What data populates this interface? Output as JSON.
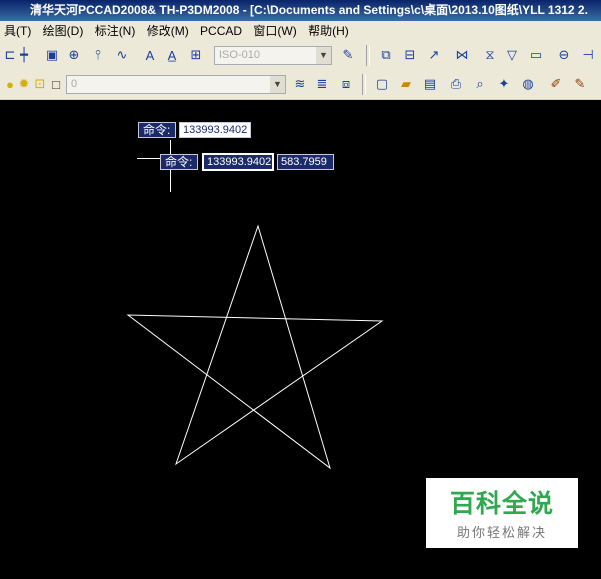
{
  "window": {
    "title": "清华天河PCCAD2008& TH-P3DM2008 - [C:\\Documents and Settings\\c\\桌面\\2013.10图纸\\YLL 1312 2."
  },
  "menu": {
    "items": [
      {
        "label": "具(T)"
      },
      {
        "label": "绘图(D)"
      },
      {
        "label": "标注(N)"
      },
      {
        "label": "修改(M)"
      },
      {
        "label": "PCCAD"
      },
      {
        "label": "窗口(W)"
      },
      {
        "label": "帮助(H)"
      }
    ]
  },
  "toolbar": {
    "style_combo_value": "ISO-010",
    "layer_combo_value": "0"
  },
  "command": {
    "label_1": "命令:",
    "value_1": "133993.9402",
    "label_2": "命令:",
    "value_2": "133993.9402",
    "value_3": "583.7959"
  },
  "watermark": {
    "title": "百科全说",
    "subtitle": "助你轻松解决"
  },
  "colors": {
    "canvas_background": "#000000",
    "drawing_stroke": "#ffffff",
    "watermark_green": "#2fa84f",
    "tooltip_background": "#1c2a6a"
  }
}
